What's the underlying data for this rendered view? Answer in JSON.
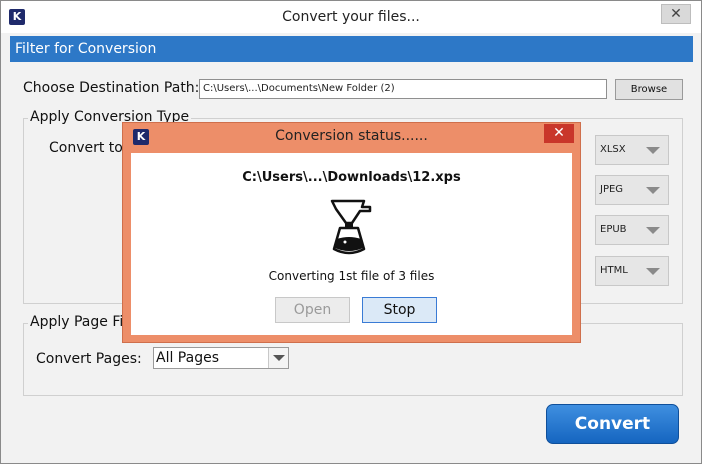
{
  "window": {
    "title": "Convert your files...",
    "close_glyph": "✕",
    "app_icon_letter": "K"
  },
  "header": {
    "title": "Filter for Conversion"
  },
  "destination": {
    "label": "Choose Destination Path:",
    "path_value": "C:\\Users\\...\\Documents\\New Folder (2)",
    "browse_label": "Browse"
  },
  "conversion_type": {
    "group_title": "Apply Conversion Type",
    "convert_to_label": "Convert to:",
    "formats": [
      "XLSX",
      "JPEG",
      "EPUB",
      "HTML"
    ]
  },
  "page_filter": {
    "group_title": "Apply Page Filter",
    "pages_label": "Convert Pages:",
    "pages_value": "All Pages"
  },
  "convert_button": {
    "label": "Convert"
  },
  "dialog": {
    "title": "Conversion status......",
    "close_glyph": "✕",
    "icon_letter": "K",
    "file_path": "C:\\Users\\...\\Downloads\\12.xps",
    "status_text": "Converting 1st file of 3 files",
    "open_label": "Open",
    "stop_label": "Stop",
    "icon": "coffee-maker-icon"
  },
  "colors": {
    "header_blue": "#2d78c7",
    "dialog_frame": "#ed8e69",
    "dialog_close": "#c9362a",
    "convert_button": "#1565c0"
  }
}
